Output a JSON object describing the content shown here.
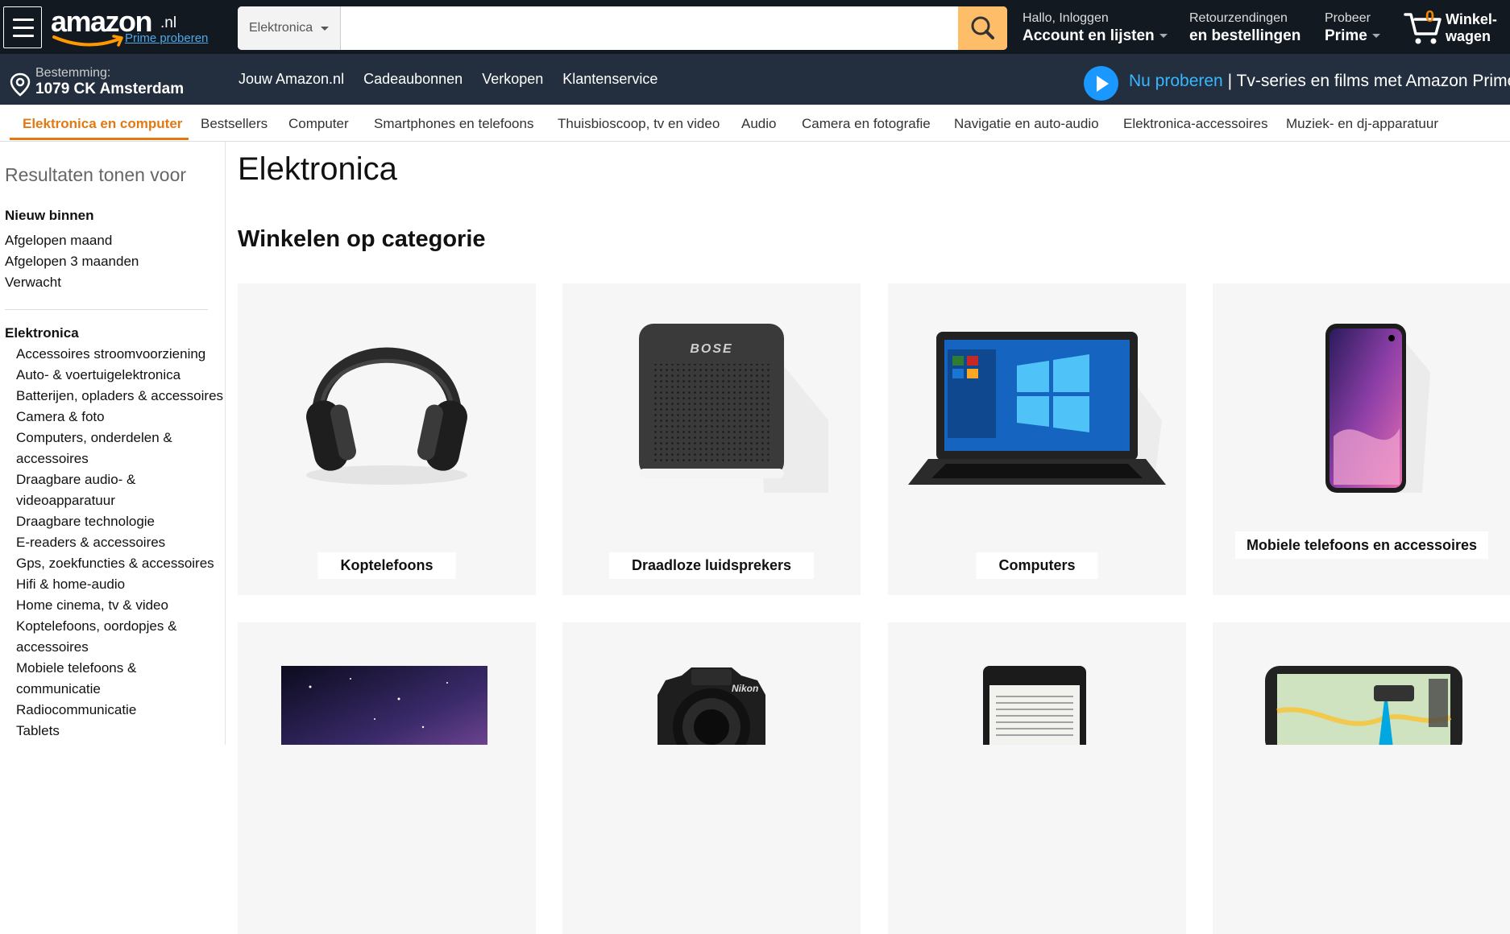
{
  "header": {
    "logo_text": "amazon",
    "logo_tld": ".nl",
    "logo_prime": "Prime proberen",
    "search_category": "Elektronica",
    "search_placeholder": "",
    "account_line1": "Hallo, Inloggen",
    "account_line2": "Account en lijsten",
    "returns_line1": "Retourzendingen",
    "returns_line2": "en bestellingen",
    "prime_line1": "Probeer",
    "prime_line2": "Prime",
    "cart_count": "0",
    "cart_line1": "Winkel-",
    "cart_line2": "wagen"
  },
  "subheader": {
    "deliver_line1": "Bestemming:",
    "deliver_line2": "1079 CK Amsterdam",
    "links": [
      "Jouw Amazon.nl",
      "Cadeaubonnen",
      "Verkopen",
      "Klantenservice"
    ],
    "promo_blue": "Nu proberen",
    "promo_rest": " | Tv-series en films met Amazon Prime"
  },
  "category_nav": {
    "items": [
      "Elektronica en computer",
      "Bestsellers",
      "Computer",
      "Smartphones en telefoons",
      "Thuisbioscoop, tv en video",
      "Audio",
      "Camera en fotografie",
      "Navigatie en auto-audio",
      "Elektronica-accessoires",
      "Muziek- en dj-apparatuur"
    ],
    "active": "Elektronica en computer"
  },
  "sidebar": {
    "title": "Resultaten tonen voor",
    "new_heading": "Nieuw binnen",
    "new_links": [
      "Afgelopen maand",
      "Afgelopen 3 maanden",
      "Verwacht"
    ],
    "category_heading": "Elektronica",
    "categories": [
      "Accessoires stroomvoorziening",
      "Auto- & voertuigelektronica",
      "Batterijen, opladers & accessoires",
      "Camera & foto",
      "Computers, onderdelen & accessoires",
      "Draagbare audio- & videoapparatuur",
      "Draagbare technologie",
      "E-readers & accessoires",
      "Gps, zoekfuncties & accessoires",
      "Hifi & home-audio",
      "Home cinema, tv & video",
      "Koptelefoons, oordopjes & accessoires",
      "Mobiele telefoons & communicatie",
      "Radiocommunicatie",
      "Tablets"
    ]
  },
  "main": {
    "page_title": "Elektronica",
    "section_title": "Winkelen op categorie",
    "tiles": [
      {
        "label": "Koptelefoons",
        "image": "headphones"
      },
      {
        "label": "Draadloze luidsprekers",
        "image": "speaker"
      },
      {
        "label": "Computers",
        "image": "laptop"
      },
      {
        "label": "Mobiele telefoons en accessoires",
        "image": "smartphone"
      },
      {
        "label": "",
        "image": "tv"
      },
      {
        "label": "",
        "image": "camera"
      },
      {
        "label": "",
        "image": "ereader"
      },
      {
        "label": "",
        "image": "gps"
      }
    ],
    "speaker_brand": "BOSE",
    "camera_brand": "Nikon"
  },
  "colors": {
    "nav_dark": "#131921",
    "nav_sub": "#232f3e",
    "search_button": "#febd69",
    "accent_orange": "#e47911",
    "prime_blue": "#37b7ff"
  }
}
